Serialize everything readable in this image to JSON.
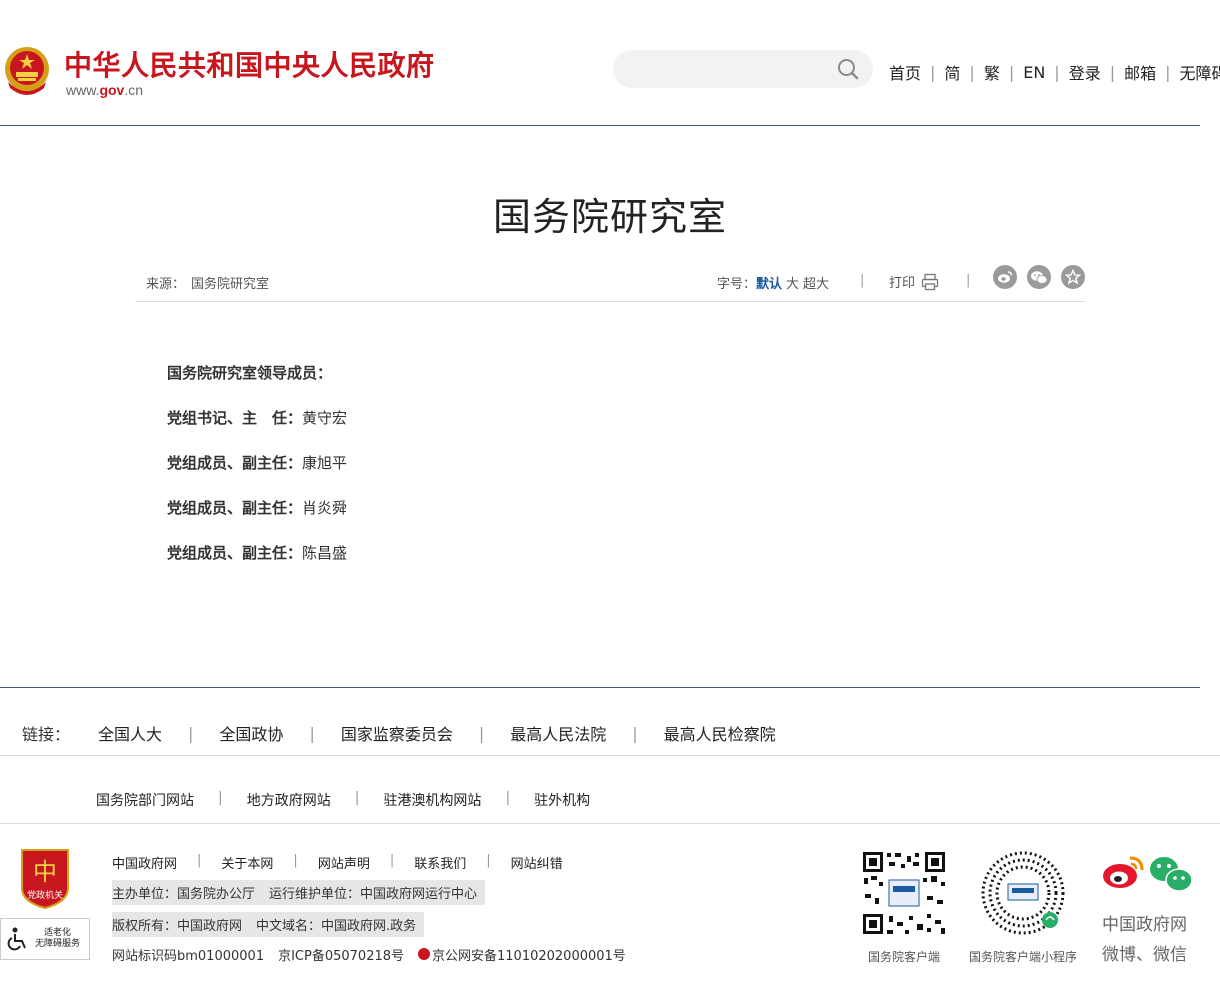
{
  "header": {
    "site_title": "中华人民共和国中央人民政府",
    "site_url_prefix": "www.",
    "site_url_gov": "gov",
    "site_url_suffix": ".cn",
    "search_placeholder": "",
    "nav": [
      "首页",
      "简",
      "繁",
      "EN",
      "登录",
      "邮箱",
      "无障碍"
    ],
    "brand_color": "#c8161e"
  },
  "article": {
    "title": "国务院研究室",
    "source_label": "来源：",
    "source_value": "国务院研究室",
    "font_size_label": "字号：",
    "font_size_options": [
      "默认",
      "大",
      "超大"
    ],
    "font_size_selected": "默认",
    "print_label": "打印",
    "share_icons": [
      "weibo-icon",
      "wechat-icon",
      "favorite-icon"
    ],
    "heading": "国务院研究室领导成员：",
    "members": [
      {
        "role": "党组书记、主　任：",
        "name": "黄守宏"
      },
      {
        "role": "党组成员、副主任：",
        "name": "康旭平"
      },
      {
        "role": "党组成员、副主任：",
        "name": "肖炎舜"
      },
      {
        "role": "党组成员、副主任：",
        "name": "陈昌盛"
      }
    ]
  },
  "links": {
    "label": "链接：",
    "primary": [
      "全国人大",
      "全国政协",
      "国家监察委员会",
      "最高人民法院",
      "最高人民检察院"
    ],
    "secondary": [
      "国务院部门网站",
      "地方政府网站",
      "驻港澳机构网站",
      "驻外机构"
    ]
  },
  "footer": {
    "badge_text": "党政机关",
    "a11y_text_1": "适老化",
    "a11y_text_2": "无障碍服务",
    "nav": [
      "中国政府网",
      "关于本网",
      "网站声明",
      "联系我们",
      "网站纠错"
    ],
    "host": "主办单位：国务院办公厅",
    "operator": "运行维护单位：中国政府网运行中心",
    "copyright": "版权所有：中国政府网",
    "domain": "中文域名：中国政府网.政务",
    "site_id": "网站标识码bm01000001",
    "icp": "京ICP备05070218号",
    "police": "京公网安备11010202000001号",
    "qr1_caption": "国务院客户端",
    "qr2_caption": "国务院客户端小程序",
    "social_line1": "中国政府网",
    "social_line2": "微博、微信"
  }
}
